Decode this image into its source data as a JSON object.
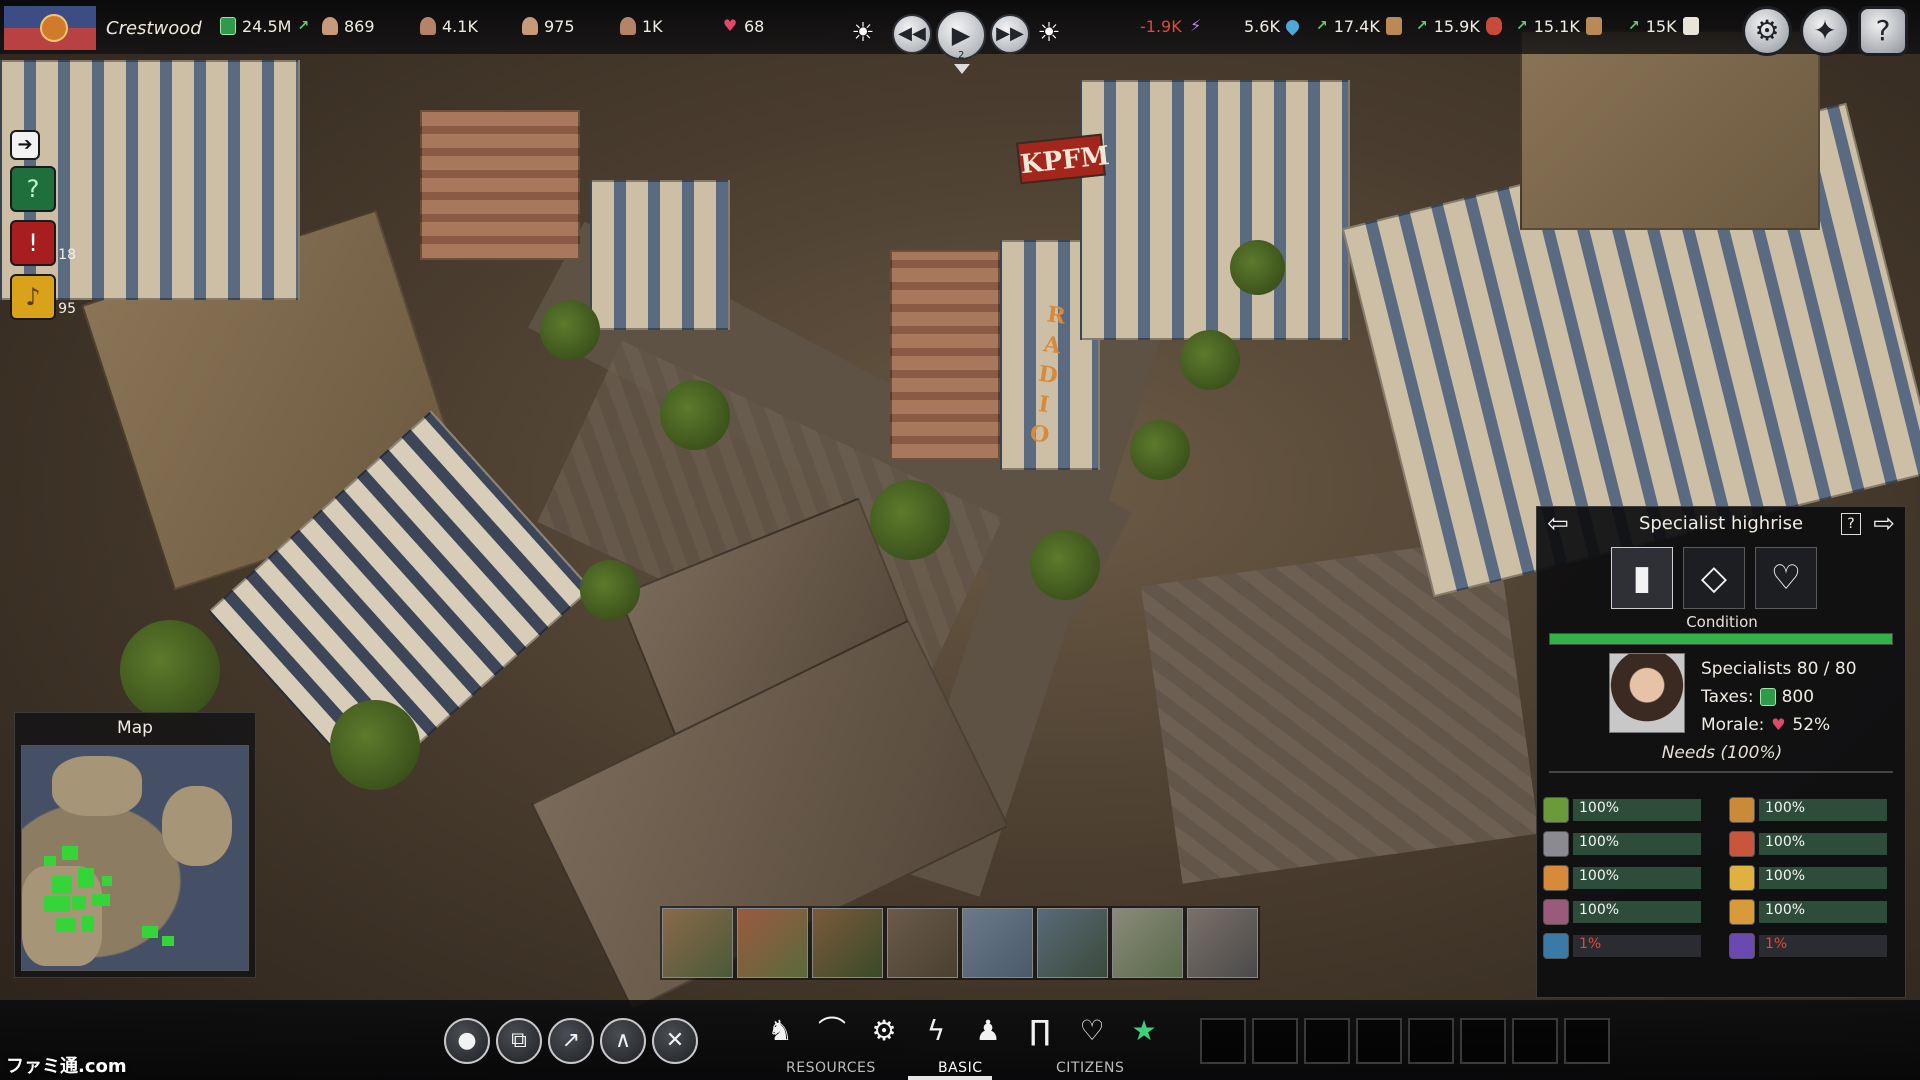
{
  "city": {
    "name": "Crestwood"
  },
  "top_stats": [
    {
      "icon": "money-icon",
      "value": "24.5M",
      "trend": "up"
    },
    {
      "icon": "worker-icon",
      "value": "869"
    },
    {
      "icon": "farmer-icon",
      "value": "4.1K"
    },
    {
      "icon": "engineer-icon",
      "value": "975"
    },
    {
      "icon": "specialist-icon",
      "value": "1K"
    },
    {
      "icon": "morale-heart-icon",
      "value": "68"
    }
  ],
  "resources": [
    {
      "icon": "power-icon",
      "value": "-1.9K",
      "negative": true
    },
    {
      "icon": "water-icon",
      "value": "5.6K",
      "trend": "up"
    },
    {
      "icon": "goods-icon",
      "value": "17.4K",
      "trend": "up"
    },
    {
      "icon": "food-icon",
      "value": "15.9K",
      "trend": "up"
    },
    {
      "icon": "materials-icon",
      "value": "15.1K",
      "trend": "up"
    },
    {
      "icon": "paper-icon",
      "value": "15K"
    }
  ],
  "speed": {
    "level": "2"
  },
  "alerts": {
    "warnings": "18",
    "notifications": "95"
  },
  "minimap": {
    "title": "Map"
  },
  "panel": {
    "title": "Specialist highrise",
    "condition_label": "Condition",
    "condition": 1.0,
    "specialists": "Specialists 80 / 80",
    "taxes_label": "Taxes:",
    "taxes": "800",
    "morale_label": "Morale:",
    "morale": "52%",
    "needs_title": "Needs (100%)",
    "needs": [
      {
        "icon": "vegetables-icon",
        "value": "100%"
      },
      {
        "icon": "bread-icon",
        "value": "100%"
      },
      {
        "icon": "tools-icon",
        "value": "100%"
      },
      {
        "icon": "meat-icon",
        "value": "100%"
      },
      {
        "icon": "soup-icon",
        "value": "100%"
      },
      {
        "icon": "drinks-icon",
        "value": "100%"
      },
      {
        "icon": "pastry-icon",
        "value": "100%"
      },
      {
        "icon": "pie-icon",
        "value": "100%"
      },
      {
        "icon": "water-need-icon",
        "value": "1%",
        "bad": true
      },
      {
        "icon": "power-need-icon",
        "value": "1%",
        "bad": true
      }
    ]
  },
  "bottom": {
    "tabs": {
      "resources": "RESOURCES",
      "basic": "BASIC",
      "citizens": "CITIZENS"
    }
  },
  "watermark": "ファミ通.com"
}
